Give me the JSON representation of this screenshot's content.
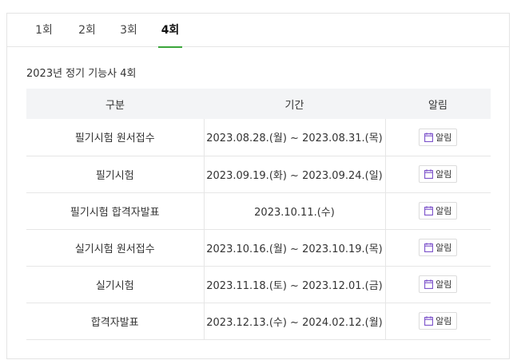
{
  "tabs": [
    {
      "label": "1회"
    },
    {
      "label": "2회"
    },
    {
      "label": "3회"
    },
    {
      "label": "4회",
      "active": true
    }
  ],
  "caption": "2023년 정기 기능사 4회",
  "table": {
    "headers": [
      "구분",
      "기간",
      "알림"
    ],
    "rows": [
      {
        "category": "필기시험 원서접수",
        "period": "2023.08.28.(월) ~ 2023.08.31.(목)",
        "alarm": "알림"
      },
      {
        "category": "필기시험",
        "period": "2023.09.19.(화) ~ 2023.09.24.(일)",
        "alarm": "알림"
      },
      {
        "category": "필기시험 합격자발표",
        "period": "2023.10.11.(수)",
        "alarm": "알림"
      },
      {
        "category": "실기시험 원서접수",
        "period": "2023.10.16.(월) ~ 2023.10.19.(목)",
        "alarm": "알림"
      },
      {
        "category": "실기시험",
        "period": "2023.11.18.(토) ~ 2023.12.01.(금)",
        "alarm": "알림"
      },
      {
        "category": "합격자발표",
        "period": "2023.12.13.(수) ~ 2024.02.12.(월)",
        "alarm": "알림"
      }
    ]
  },
  "colors": {
    "accent": "#3aa63a",
    "icon": "#7a4fc9",
    "header_bg": "#f3f4f6"
  },
  "icons": {
    "alarm": "calendar-icon"
  }
}
